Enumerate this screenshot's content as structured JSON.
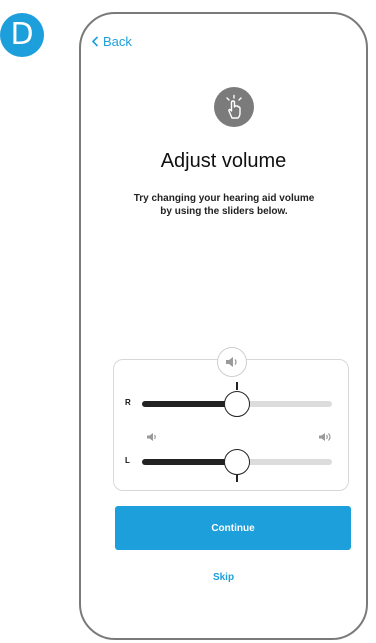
{
  "step_badge": "D",
  "nav": {
    "back_label": "Back"
  },
  "header": {
    "icon": "hand-tap-icon",
    "title": "Adjust volume",
    "subtitle": "Try changing your hearing aid volume\nby using the sliders below."
  },
  "volume": {
    "top_icon": "speaker-icon",
    "right": {
      "label": "R",
      "level": 0.5
    },
    "left": {
      "label": "L",
      "level": 0.5
    },
    "low_icon": "speaker-low-icon",
    "high_icon": "speaker-high-icon"
  },
  "actions": {
    "continue_label": "Continue",
    "skip_label": "Skip"
  },
  "colors": {
    "accent": "#1c9fda",
    "frame": "#7a7a7a",
    "icon_bg": "#7b7b7b",
    "track_fill": "#222222",
    "track_empty": "#dcdcdc"
  }
}
